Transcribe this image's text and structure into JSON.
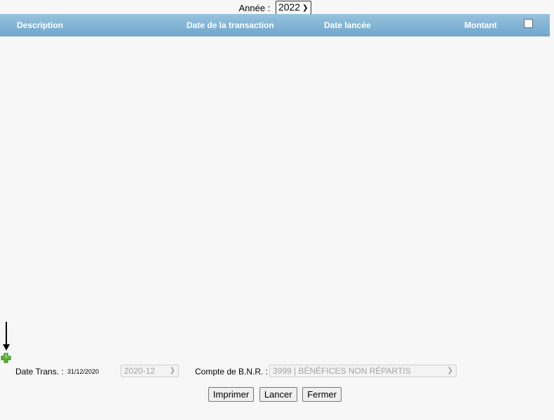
{
  "year_selector": {
    "label": "Année :",
    "selected": "2022"
  },
  "table": {
    "columns": {
      "description": "Description",
      "transaction_date": "Date de la transaction",
      "launched_date": "Date lancée",
      "amount": "Montant"
    },
    "select_all_checked": false,
    "rows": []
  },
  "icons": {
    "arrow": "arrow-down-icon",
    "add": "plus-icon"
  },
  "colors": {
    "header_top": "#97c3de",
    "header_bottom": "#6fa6cb",
    "add_icon": "#5cb531"
  },
  "form": {
    "date_trans_label": "Date Trans. :",
    "date_trans_value": "31/12/2020",
    "period_selected": "2020-12",
    "bnr_label": "Compte de B.N.R. :",
    "bnr_selected": "3999 | BÉNÉFICES NON RÉPARTIS"
  },
  "buttons": {
    "print": "Imprimer",
    "launch": "Lancer",
    "close": "Fermer"
  }
}
